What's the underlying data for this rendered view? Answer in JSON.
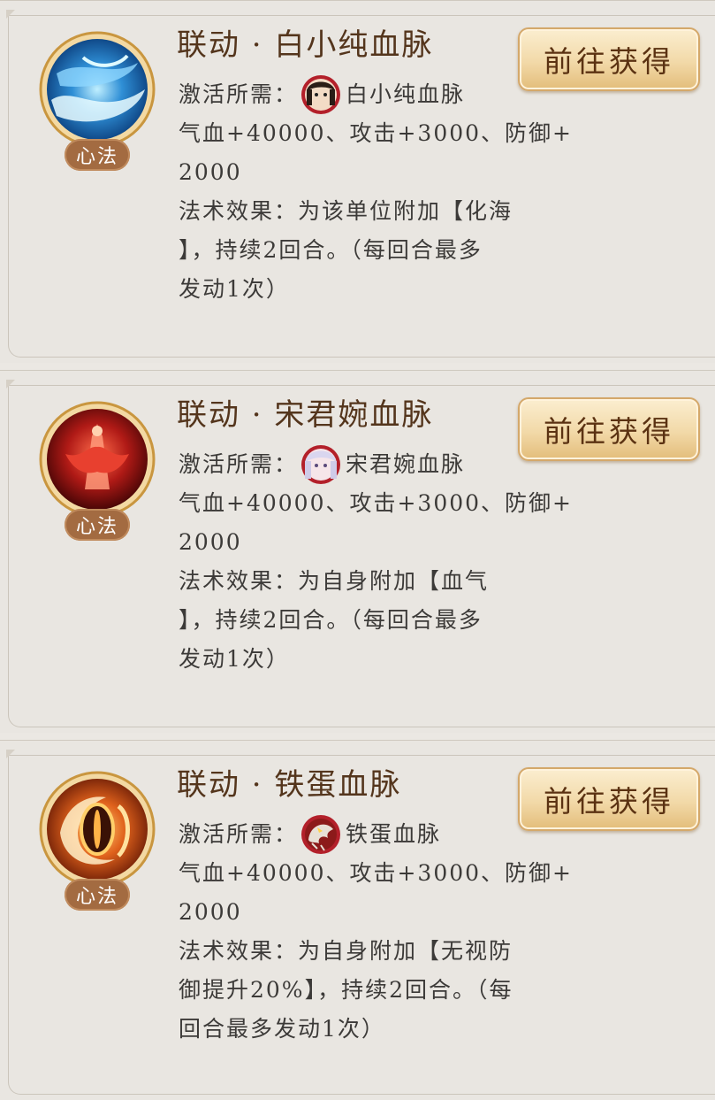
{
  "cards": [
    {
      "title": "联动 · 白小纯血脉",
      "tag": "心法",
      "button": "前往获得",
      "req_label": "激活所需：",
      "req_name": "白小纯血脉",
      "stats": [
        "气血+40000、攻击+3000、防御+",
        "2000"
      ],
      "effect": [
        "法术效果：为该单位附加【化海",
        "】，持续2回合。（每回合最多",
        "发动1次）"
      ],
      "icon": "blue-wave-icon",
      "portrait": "bai-xiaochun-portrait"
    },
    {
      "title": "联动 · 宋君婉血脉",
      "tag": "心法",
      "button": "前往获得",
      "req_label": "激活所需：",
      "req_name": "宋君婉血脉",
      "stats": [
        "气血+40000、攻击+3000、防御+",
        "2000"
      ],
      "effect": [
        "法术效果：为自身附加【血气",
        "】，持续2回合。（每回合最多",
        "发动1次）"
      ],
      "icon": "red-figure-icon",
      "portrait": "song-junwan-portrait"
    },
    {
      "title": "联动 · 铁蛋血脉",
      "tag": "心法",
      "button": "前往获得",
      "req_label": "激活所需：",
      "req_name": "铁蛋血脉",
      "stats": [
        "气血+40000、攻击+3000、防御+",
        "2000"
      ],
      "effect": [
        "法术效果：为自身附加【无视防",
        "御提升20%】，持续2回合。（每",
        "回合最多发动1次）"
      ],
      "icon": "fire-eye-icon",
      "portrait": "tiedan-portrait"
    }
  ]
}
